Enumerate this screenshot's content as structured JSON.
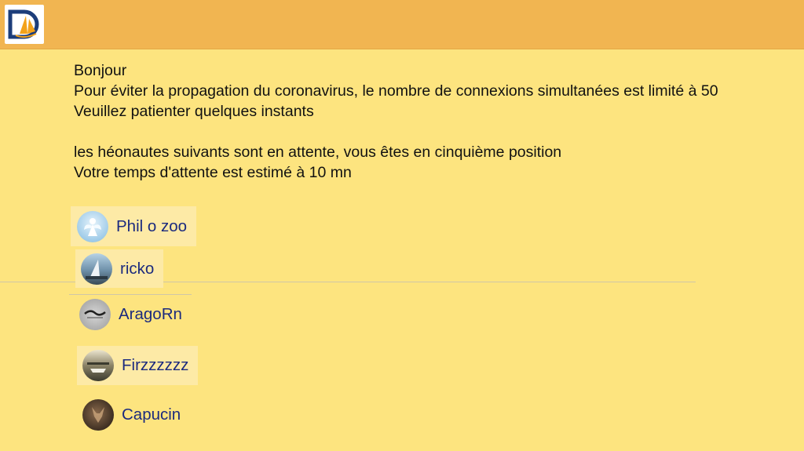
{
  "header": {
    "logo_icon": "sailboat-logo-icon",
    "brand_colors": {
      "bar": "#f1b551",
      "background": "#fde47f",
      "logo_blue": "#1c3d7a",
      "logo_orange": "#f3a21a"
    }
  },
  "message": {
    "greeting": "Bonjour",
    "line1": "Pour éviter la propagation du coronavirus, le nombre de connexions simultanées est limité à 50",
    "line2": "Veuillez patienter quelques instants",
    "line3": "les héonautes suivants sont en attente, vous êtes en cinquième position",
    "line4": "Votre temps d'attente est estimé à 10 mn"
  },
  "waiting_users": [
    {
      "name": "Phil o zoo",
      "avatar": "angel-avatar"
    },
    {
      "name": "ricko",
      "avatar": "sailboat-avatar"
    },
    {
      "name": "AragoRn",
      "avatar": "logo-avatar"
    },
    {
      "name": "Firzzzzzz",
      "avatar": "harbor-avatar"
    },
    {
      "name": "Capucin",
      "avatar": "animal-avatar"
    }
  ],
  "colors": {
    "username": "#1b2a7e",
    "text": "#111111",
    "highlight": "#fdeaa6"
  }
}
